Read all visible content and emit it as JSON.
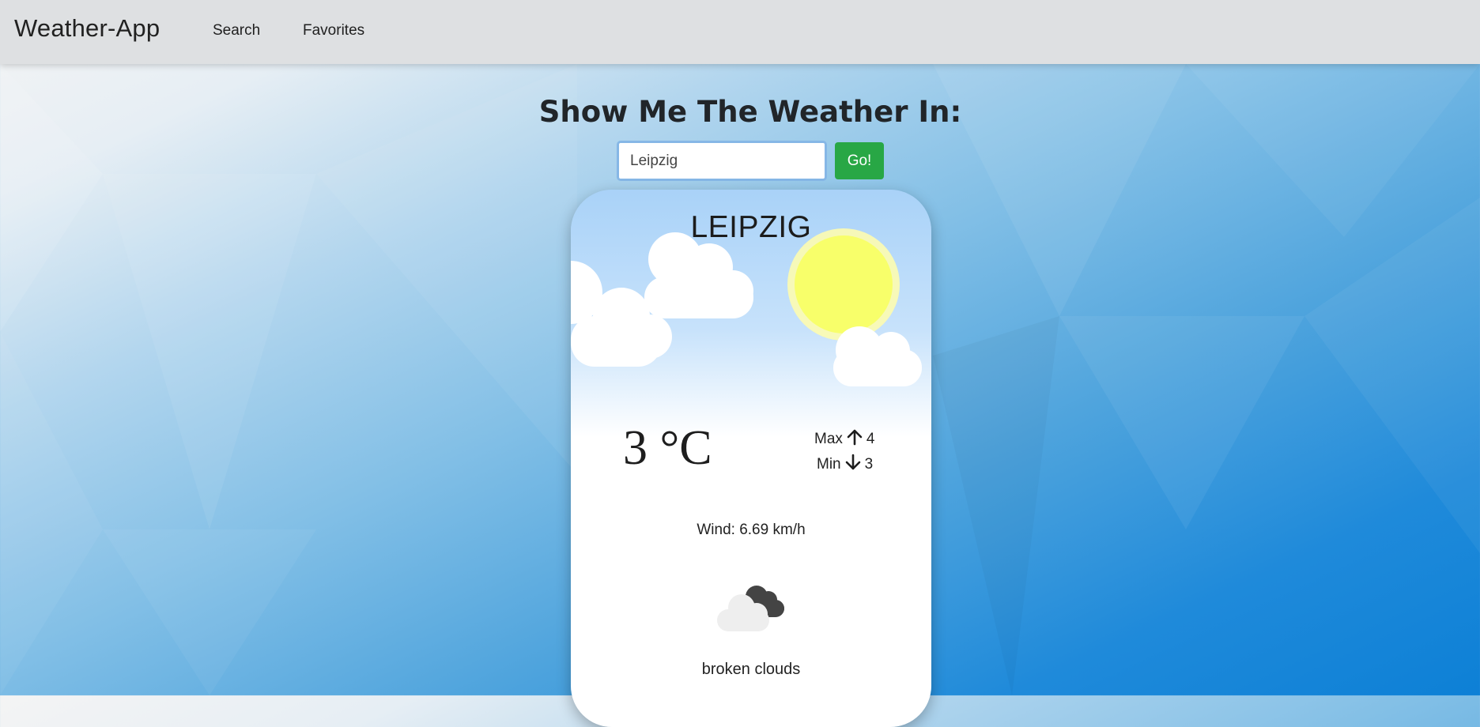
{
  "app": {
    "title": "Weather-App"
  },
  "nav": {
    "search_label": "Search",
    "favorites_label": "Favorites"
  },
  "search": {
    "heading": "Show Me The Weather In:",
    "value": "Leipzig",
    "go_label": "Go!"
  },
  "weather": {
    "city": "LEIPZIG",
    "temperature": "3 °C",
    "max_label": "Max",
    "max_value": "4",
    "min_label": "Min",
    "min_value": "3",
    "wind": "Wind: 6.69 km/h",
    "description": "broken clouds",
    "condition_icon": "broken-clouds-icon"
  },
  "colors": {
    "accent_go": "#28a745",
    "navbar": "#dee0e2",
    "sun": "#f8ff6a"
  }
}
